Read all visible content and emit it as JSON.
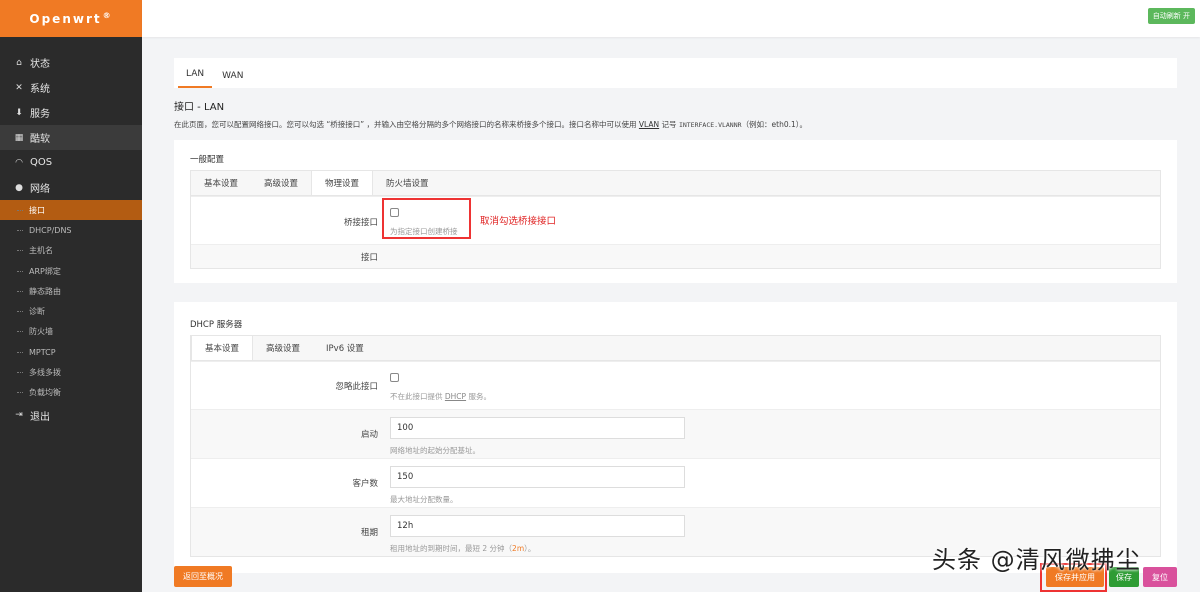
{
  "brand": {
    "name": "Openwrt",
    "mark": "®"
  },
  "topbar": {
    "auto_refresh": "自动刷新 开"
  },
  "sidebar": {
    "items": [
      {
        "label": "状态",
        "icon": "home-icon"
      },
      {
        "label": "系统",
        "icon": "tools-icon"
      },
      {
        "label": "服务",
        "icon": "download-icon"
      },
      {
        "label": "酷软",
        "icon": "grid-icon"
      },
      {
        "label": "QOS",
        "icon": "gauge-icon"
      },
      {
        "label": "网络",
        "icon": "globe-icon"
      }
    ],
    "network_sub": [
      "接口",
      "DHCP/DNS",
      "主机名",
      "ARP绑定",
      "静态路由",
      "诊断",
      "防火墙",
      "MPTCP",
      "多线多拨",
      "负载均衡"
    ],
    "logout": "退出"
  },
  "tabs": [
    "LAN",
    "WAN"
  ],
  "page": {
    "title": "接口 - LAN",
    "desc_prefix": "在此页面，您可以配置网络接口。您可以勾选 “桥接接口” ，并输入由空格分隔的多个网络接口的名称来桥接多个接口。接口名称中可以使用 ",
    "desc_vlan": "VLAN",
    "desc_mid": " 记号 ",
    "desc_code": "INTERFACE.VLANNR",
    "desc_suffix": "（例如：eth0.1）。"
  },
  "general": {
    "title": "一般配置",
    "tabs": [
      "基本设置",
      "高级设置",
      "物理设置",
      "防火墙设置"
    ],
    "bridge_label": "桥接接口",
    "bridge_hint": "为指定接口创建桥接",
    "annotation": "取消勾选桥接接口",
    "interface_label": "接口"
  },
  "dhcp": {
    "title": "DHCP 服务器",
    "tabs": [
      "基本设置",
      "高级设置",
      "IPv6 设置"
    ],
    "ignore_label": "忽略此接口",
    "ignore_hint_a": "不在此接口提供 ",
    "ignore_hint_dhcp": "DHCP",
    "ignore_hint_b": " 服务。",
    "start_label": "启动",
    "start_value": "100",
    "start_hint": "网络地址的起始分配基址。",
    "limit_label": "客户数",
    "limit_value": "150",
    "limit_hint": "最大地址分配数量。",
    "lease_label": "租期",
    "lease_value": "12h",
    "lease_hint_a": "租用地址的到期时间，最短 2 分钟（",
    "lease_hint_code": "2m",
    "lease_hint_b": "）。"
  },
  "buttons": {
    "back": "返回至概况",
    "save_apply": "保存并应用",
    "save": "保存",
    "reset": "复位"
  },
  "watermark": "头条 @清风微拂尘",
  "colors": {
    "brand_orange": "#f07a24",
    "green": "#4caf50",
    "pink": "#d9519c",
    "red_annotation": "#e02424"
  }
}
